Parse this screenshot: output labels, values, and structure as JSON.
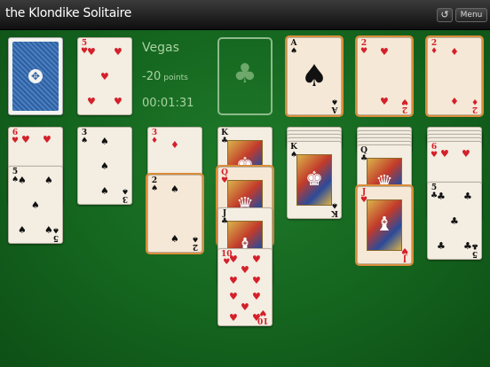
{
  "app": {
    "title": "the Klondike Solitaire"
  },
  "toolbar": {
    "undo_icon": "↺",
    "menu_label": "Menu"
  },
  "status": {
    "mode": "Vegas",
    "score": "-20",
    "score_unit": "points",
    "timer": "00:01:31"
  },
  "stock": {
    "icon": "card-back"
  },
  "foundation_slot": {
    "icon": "♣"
  },
  "colors": {
    "felt": "#14641e",
    "highlight": "#d98d3a",
    "red": "#d4202a"
  },
  "cards": {
    "waste": {
      "rank": "5",
      "suit": "♥"
    },
    "f1": {
      "rank": "A",
      "suit": "♠"
    },
    "f2": {
      "rank": "2",
      "suit": "♥"
    },
    "f3": {
      "rank": "2",
      "suit": "♦"
    },
    "t1a": {
      "rank": "6",
      "suit": "♥"
    },
    "t1b": {
      "rank": "5",
      "suit": "♠"
    },
    "t2a": {
      "rank": "3",
      "suit": "♠"
    },
    "t3a": {
      "rank": "3",
      "suit": "♦"
    },
    "t3b": {
      "rank": "2",
      "suit": "♠"
    },
    "t4a": {
      "rank": "K",
      "suit": "♣"
    },
    "t4b": {
      "rank": "Q",
      "suit": "♥"
    },
    "t4c": {
      "rank": "J",
      "suit": "♣"
    },
    "t4d": {
      "rank": "10",
      "suit": "♥"
    },
    "t5a": {
      "rank": "K",
      "suit": "♠"
    },
    "t6a": {
      "rank": "Q",
      "suit": "♣"
    },
    "t6b": {
      "rank": "J",
      "suit": "♥"
    },
    "t7a": {
      "rank": "6",
      "suit": "♥"
    },
    "t7b": {
      "rank": "5",
      "suit": "♣"
    }
  }
}
